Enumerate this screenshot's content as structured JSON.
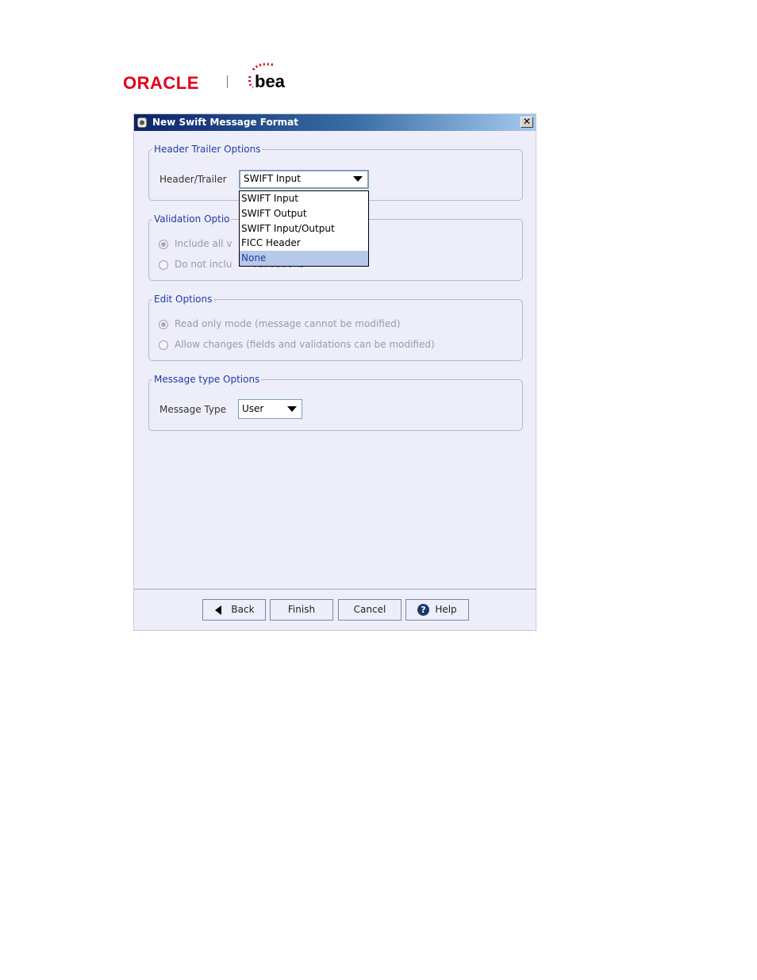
{
  "logo": {
    "oracle_text": "ORACLE",
    "bea_text": "bea"
  },
  "dialog": {
    "title": "New Swift Message Format",
    "close_glyph": "✕"
  },
  "header_trailer": {
    "legend": "Header Trailer Options",
    "label": "Header/Trailer",
    "selected": "SWIFT Input",
    "options": [
      "SWIFT Input",
      "SWIFT Output",
      "SWIFT Input/Output",
      "FICC Header",
      "None"
    ],
    "highlighted": "None"
  },
  "validation": {
    "legend": "Validation Optio",
    "option1": "Include all v",
    "option2": "Do not inclu",
    "option2_tail": "validations",
    "selected_index": 0
  },
  "edit": {
    "legend": "Edit Options",
    "option1": "Read only mode (message cannot be modified)",
    "option2": "Allow changes (fields and validations can be modified)",
    "selected_index": 0
  },
  "message_type": {
    "legend": "Message type Options",
    "label": "Message Type",
    "selected": "User"
  },
  "buttons": {
    "back": "Back",
    "finish": "Finish",
    "cancel": "Cancel",
    "help": "Help"
  },
  "colors": {
    "accent": "#1c3ea0",
    "dialog_bg": "#eeeefa",
    "title_start": "#0a246a",
    "oracle_red": "#e2001a"
  }
}
